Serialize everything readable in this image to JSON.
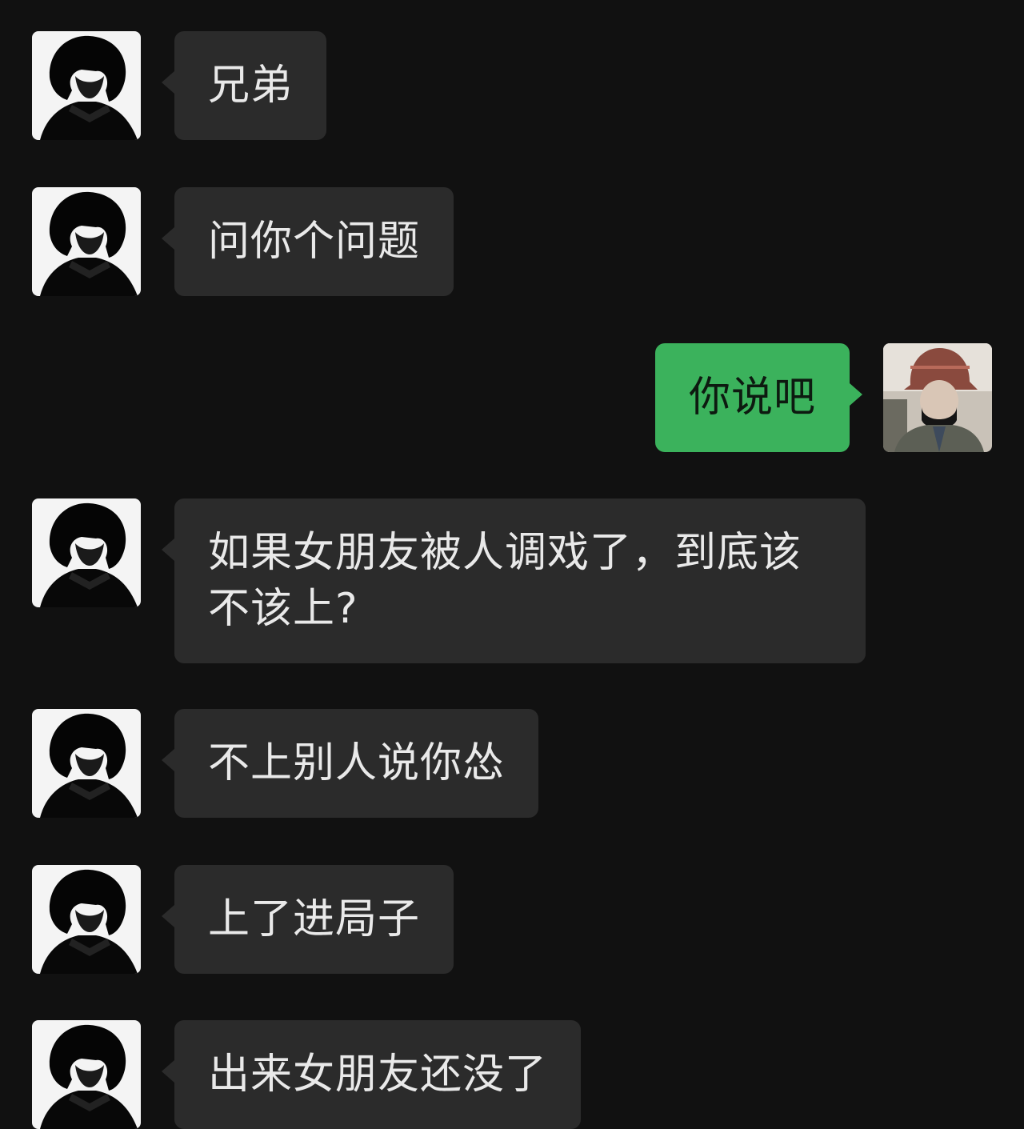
{
  "colors": {
    "background": "#111111",
    "incoming_bubble": "#2b2b2b",
    "outgoing_bubble": "#3bb25c",
    "incoming_text": "#e9e9e9",
    "outgoing_text": "#0d1a10"
  },
  "messages": [
    {
      "side": "left",
      "avatar": "anime-boy-avatar",
      "text": "兄弟"
    },
    {
      "side": "left",
      "avatar": "anime-boy-avatar",
      "text": "问你个问题"
    },
    {
      "side": "right",
      "avatar": "user-photo-avatar",
      "text": "你说吧"
    },
    {
      "side": "left",
      "avatar": "anime-boy-avatar",
      "text": "如果女朋友被人调戏了，到底该不该上?"
    },
    {
      "side": "left",
      "avatar": "anime-boy-avatar",
      "text": "不上别人说你怂"
    },
    {
      "side": "left",
      "avatar": "anime-boy-avatar",
      "text": "上了进局子"
    },
    {
      "side": "left",
      "avatar": "anime-boy-avatar",
      "text": "出来女朋友还没了"
    }
  ]
}
